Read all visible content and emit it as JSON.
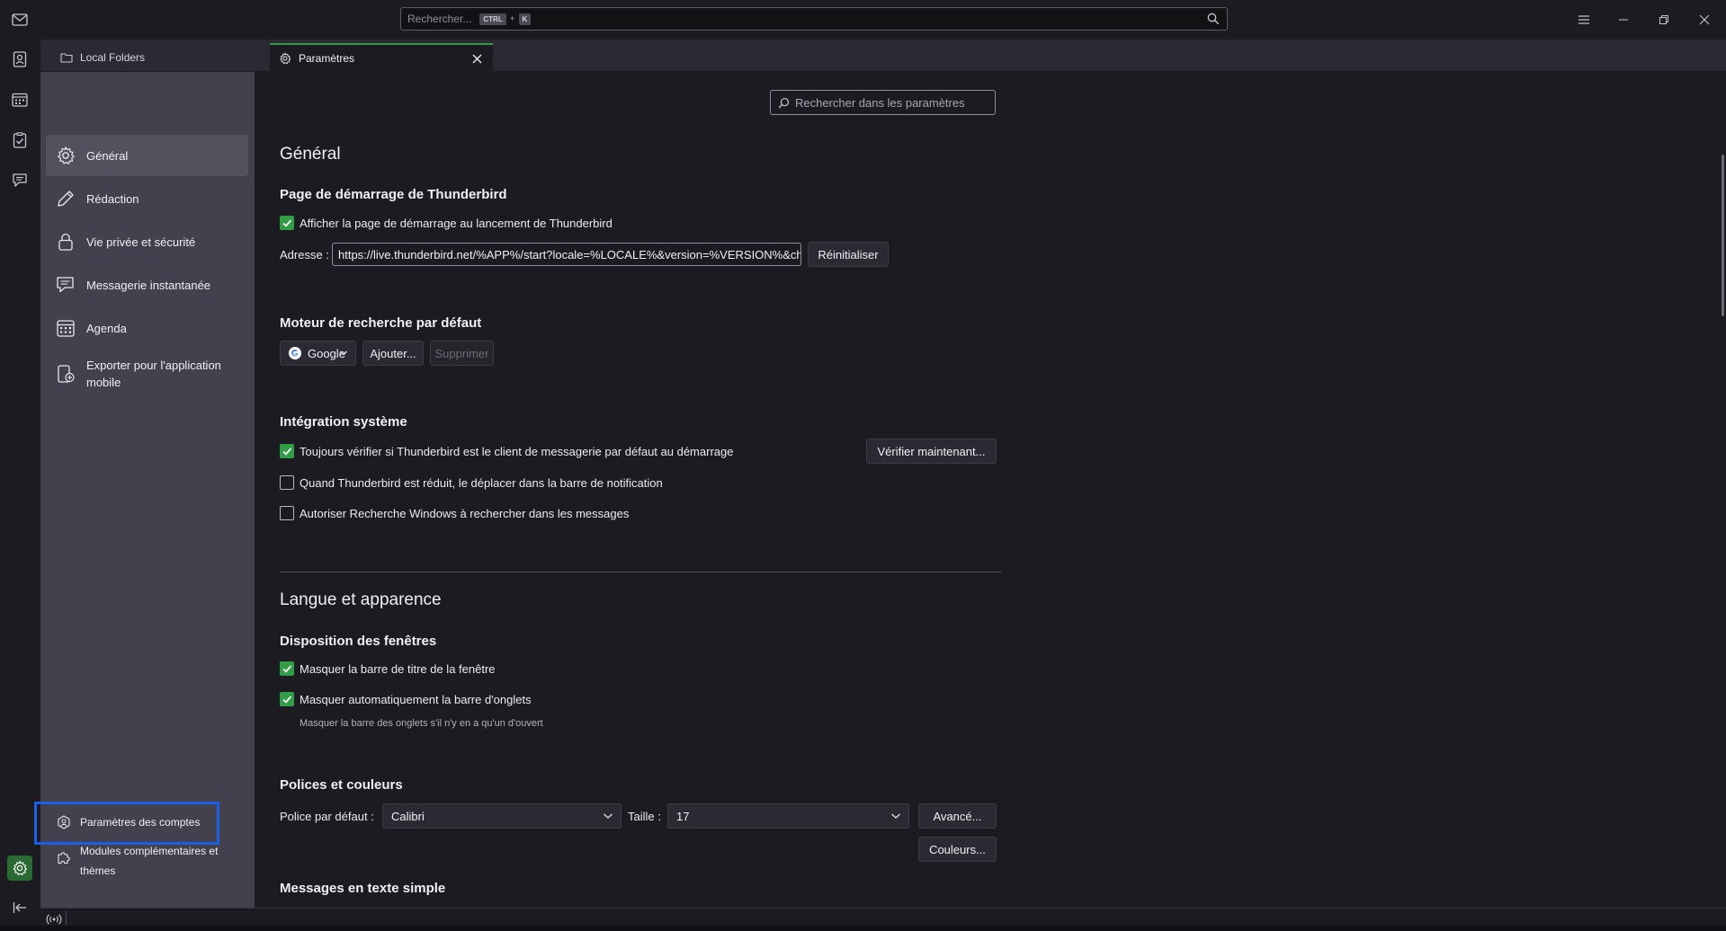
{
  "topbar": {
    "search_placeholder": "Rechercher...",
    "shortcut_ctrl": "CTRL",
    "shortcut_plus": "+",
    "shortcut_key": "K"
  },
  "tabs": [
    {
      "label": "Local Folders",
      "icon": "folder-icon"
    },
    {
      "label": "Paramètres",
      "icon": "gear-icon"
    }
  ],
  "sidebar": {
    "categories": [
      {
        "label": "Général",
        "icon": "gear-icon",
        "selected": true
      },
      {
        "label": "Rédaction",
        "icon": "pencil-icon"
      },
      {
        "label": "Vie privée et sécurité",
        "icon": "lock-icon"
      },
      {
        "label": "Messagerie instantanée",
        "icon": "chat-icon"
      },
      {
        "label": "Agenda",
        "icon": "calendar-icon"
      },
      {
        "label": "Exporter pour l'application mobile",
        "icon": "mobile-export-icon"
      }
    ],
    "account_settings": "Paramètres des comptes",
    "addons": "Modules complémentaires et thèmes"
  },
  "content": {
    "search_placeholder": "Rechercher dans les paramètres",
    "general_title": "Général",
    "startup": {
      "heading": "Page de démarrage de Thunderbird",
      "show_start_label": "Afficher la page de démarrage au lancement de Thunderbird",
      "show_start_checked": true,
      "address_label": "Adresse :",
      "address_value": "https://live.thunderbird.net/%APP%/start?locale=%LOCALE%&version=%VERSION%&channel=%CHANNEL%",
      "reset_button": "Réinitialiser"
    },
    "search_engine": {
      "heading": "Moteur de recherche par défaut",
      "selected": "Google",
      "add_button": "Ajouter...",
      "remove_button": "Supprimer"
    },
    "system": {
      "heading": "Intégration système",
      "always_check_label": "Toujours vérifier si Thunderbird est le client de messagerie par défaut au démarrage",
      "always_check_checked": true,
      "check_now_button": "Vérifier maintenant...",
      "minimize_tray_label": "Quand Thunderbird est réduit, le déplacer dans la barre de notification",
      "minimize_tray_checked": false,
      "windows_search_label": "Autoriser Recherche Windows à rechercher dans les messages",
      "windows_search_checked": false
    },
    "language_title": "Langue et apparence",
    "window_layout": {
      "heading": "Disposition des fenêtres",
      "hide_titlebar_label": "Masquer la barre de titre de la fenêtre",
      "hide_titlebar_checked": true,
      "autohide_tabs_label": "Masquer automatiquement la barre d'onglets",
      "autohide_tabs_checked": true,
      "autohide_note": "Masquer la barre des onglets s'il n'y en a qu'un d'ouvert"
    },
    "fonts": {
      "heading": "Polices et couleurs",
      "default_font_label": "Police par défaut :",
      "default_font_value": "Calibri",
      "size_label": "Taille :",
      "size_value": "17",
      "advanced_button": "Avancé...",
      "colors_button": "Couleurs..."
    },
    "plain_text_heading": "Messages en texte simple"
  },
  "colors": {
    "accent_green": "#2f9e44",
    "highlight_blue": "#1a5fe6",
    "sidebar_bg": "#42414d",
    "content_bg": "#1c1b22"
  }
}
